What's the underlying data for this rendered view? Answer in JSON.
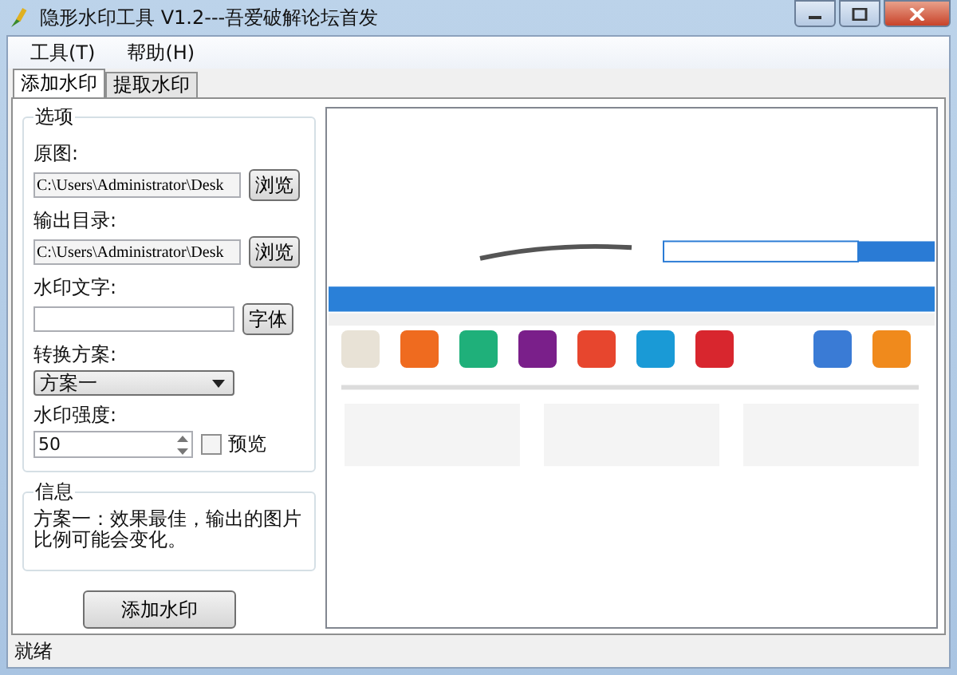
{
  "window": {
    "title": "隐形水印工具 V1.2---吾爱破解论坛首发"
  },
  "menu": [
    {
      "label": "工具(T)"
    },
    {
      "label": "帮助(H)"
    }
  ],
  "tabs": [
    {
      "label": "添加水印",
      "selected": true
    },
    {
      "label": "提取水印",
      "selected": false
    }
  ],
  "options": {
    "title": "选项",
    "source": {
      "label": "原图:",
      "value": "C:\\Users\\Administrator\\Desk",
      "button": "浏览"
    },
    "output": {
      "label": "输出目录:",
      "value": "C:\\Users\\Administrator\\Desk",
      "button": "浏览"
    },
    "watermark_text": {
      "label": "水印文字:",
      "button": "字体"
    },
    "scheme": {
      "label": "转换方案:",
      "value": "方案一"
    },
    "strength": {
      "label": "水印强度:",
      "value": "50"
    },
    "preview": {
      "label": "预览",
      "checked": false
    }
  },
  "info": {
    "title": "信息",
    "text": "方案一：效果最佳，输出的图片比例可能会变化。"
  },
  "action_button": "添加水印",
  "status_bar": "就绪"
}
